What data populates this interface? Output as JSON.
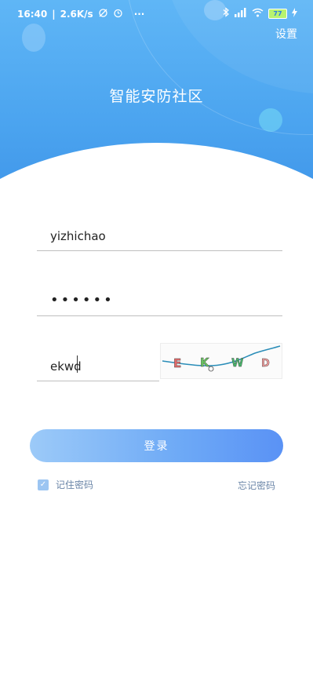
{
  "status_bar": {
    "time": "16:40",
    "network_speed": "2.6K/s",
    "more": "···",
    "battery_level": "77"
  },
  "header": {
    "settings_label": "设置",
    "app_title": "智能安防社区"
  },
  "form": {
    "username_value": "yizhichao",
    "password_masked": "••••••",
    "captcha_value": "ekwd",
    "captcha_image_text": [
      "E",
      "K",
      "W",
      "D"
    ]
  },
  "login_button_label": "登录",
  "remember_password_label": "记住密码",
  "remember_password_checked": true,
  "forgot_password_label": "忘记密码",
  "colors": {
    "header_blue": "#4aa3ef",
    "button_start": "#9ccaf8",
    "button_end": "#5a92f5",
    "link_text": "#6b86a8"
  }
}
